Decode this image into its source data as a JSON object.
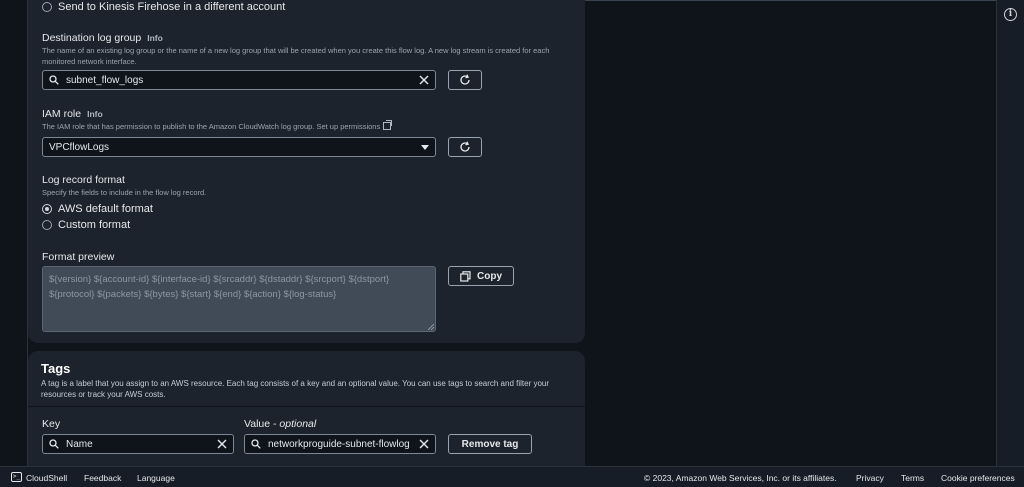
{
  "kinesis_option": {
    "label": "Send to Kinesis Firehose in a different account"
  },
  "destination_log_group": {
    "label": "Destination log group",
    "info": "Info",
    "description": "The name of an existing log group or the name of a new log group that will be created when you create this flow log. A new log stream is created for each monitored network interface.",
    "value": "subnet_flow_logs"
  },
  "iam_role": {
    "label": "IAM role",
    "info": "Info",
    "description": "The IAM role that has permission to publish to the Amazon CloudWatch log group. Set up permissions",
    "value": "VPCflowLogs"
  },
  "log_record_format": {
    "label": "Log record format",
    "description": "Specify the fields to include in the flow log record.",
    "options": [
      {
        "label": "AWS default format",
        "selected": true
      },
      {
        "label": "Custom format",
        "selected": false
      }
    ]
  },
  "format_preview": {
    "label": "Format preview",
    "text": "${version} ${account-id} ${interface-id} ${srcaddr} ${dstaddr} ${srcport} ${dstport} ${protocol} ${packets} ${bytes} ${start} ${end} ${action} ${log-status}",
    "copy_label": "Copy"
  },
  "tags": {
    "title": "Tags",
    "description": "A tag is a label that you assign to an AWS resource. Each tag consists of a key and an optional value. You can use tags to search and filter your resources or track your AWS costs.",
    "key_header": "Key",
    "value_header": "Value - ",
    "value_header_optional": "optional",
    "rows": [
      {
        "key": "Name",
        "value": "networkproguide-subnet-flowlog"
      }
    ],
    "remove_label": "Remove tag"
  },
  "footer": {
    "cloudshell": "CloudShell",
    "feedback": "Feedback",
    "language": "Language",
    "copyright": "© 2023, Amazon Web Services, Inc. or its affiliates.",
    "privacy": "Privacy",
    "terms": "Terms",
    "cookies": "Cookie preferences"
  },
  "icons": {
    "info": "info-icon",
    "search": "search-icon",
    "clear": "clear-icon",
    "refresh": "refresh-icon",
    "copy": "copy-icon",
    "external_link": "external-link-icon",
    "cloudshell": "cloudshell-icon"
  }
}
